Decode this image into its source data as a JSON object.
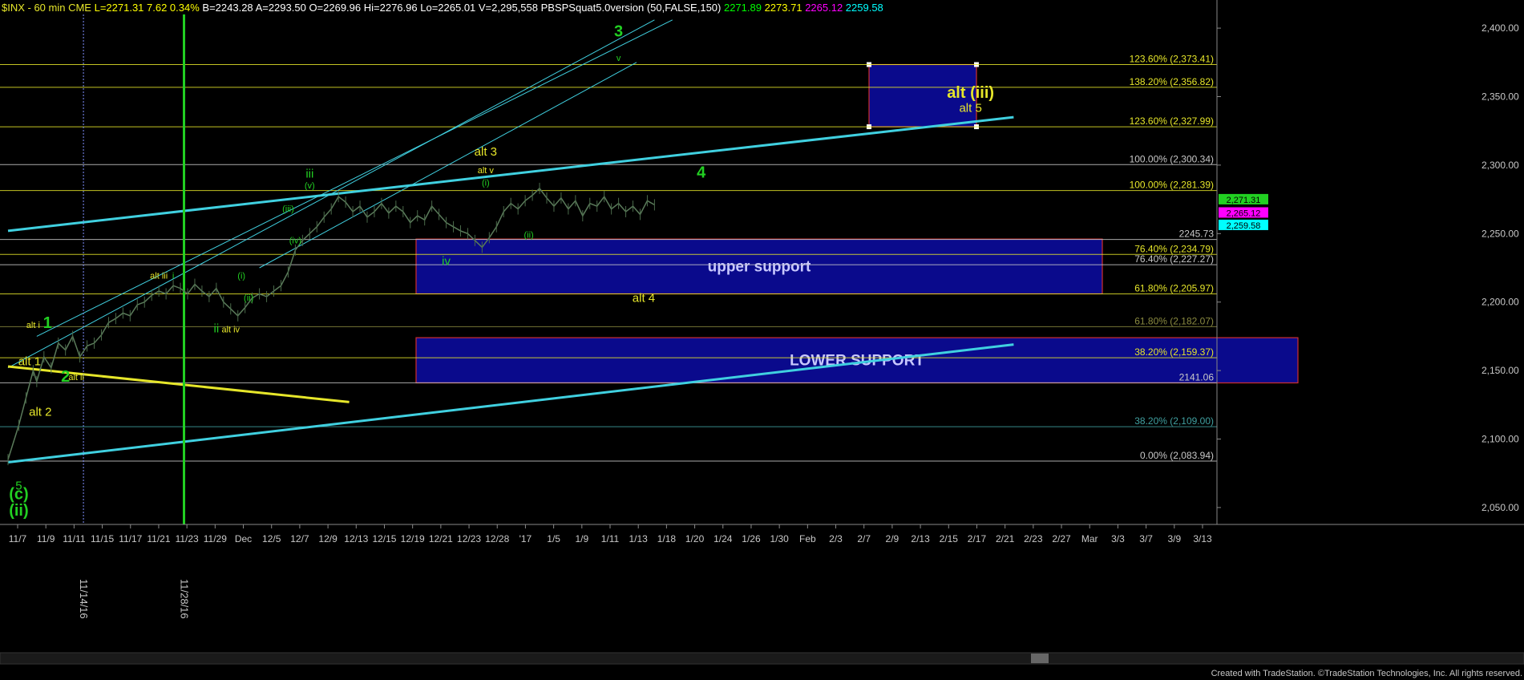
{
  "header": {
    "symbol": "$INX - 60 min  CME",
    "segments": [
      {
        "text": "L=2271.31  7.62  0.34%",
        "color": "#ffff00"
      },
      {
        "text": "B=2243.28",
        "color": "#ffffff"
      },
      {
        "text": "A=2293.50",
        "color": "#ffffff"
      },
      {
        "text": "O=2269.96",
        "color": "#ffffff"
      },
      {
        "text": "Hi=2276.96",
        "color": "#ffffff"
      },
      {
        "text": "Lo=2265.01",
        "color": "#ffffff"
      },
      {
        "text": "V=2,295,558",
        "color": "#ffffff"
      },
      {
        "text": "PBSPSquat5.0version (50,FALSE,150)",
        "color": "#ffffff"
      },
      {
        "text": "2271.89",
        "color": "#00ff00"
      },
      {
        "text": "2273.71",
        "color": "#ffff00"
      },
      {
        "text": "2265.12",
        "color": "#ff00ff"
      },
      {
        "text": "2259.58",
        "color": "#00ffff"
      }
    ]
  },
  "footer": {
    "credit": "Created with TradeStation. ©TradeStation Technologies, Inc. All rights reserved."
  },
  "colors": {
    "background": "#000000",
    "price_line": "#5a7a5a",
    "trend_cyan": "#40d0e0",
    "trend_yellow": "#e6e62a",
    "marker_green": "#22d022",
    "box_fill": "#0a0a8c",
    "box_border": "#d03030",
    "label_yellow": "#e6e62a",
    "label_green": "#22d022"
  },
  "chart_data": {
    "type": "line",
    "title": "$INX - 60 min",
    "ylim": [
      2040,
      2410
    ],
    "y_ticks": [
      "2,050.00",
      "2,100.00",
      "2,150.00",
      "2,200.00",
      "2,250.00",
      "2,300.00",
      "2,350.00",
      "2,400.00"
    ],
    "x_ticks": [
      "11/7",
      "11/9",
      "11/11",
      "11/15",
      "11/17",
      "11/21",
      "11/23",
      "11/29",
      "Dec",
      "12/5",
      "12/7",
      "12/9",
      "12/13",
      "12/15",
      "12/19",
      "12/21",
      "12/23",
      "12/28",
      "'17",
      "1/5",
      "1/9",
      "1/11",
      "1/13",
      "1/18",
      "1/20",
      "1/24",
      "1/26",
      "1/30",
      "Feb",
      "2/3",
      "2/7",
      "2/9",
      "2/13",
      "2/15",
      "2/17",
      "2/21",
      "2/23",
      "2/27",
      "Mar",
      "3/3",
      "3/7",
      "3/9",
      "3/13"
    ],
    "x_index": "bar index (0 = 11/4 close, 11/7 starts at 1)",
    "series": [
      {
        "values_by_bar": [
          [
            0,
            2085
          ],
          [
            3,
            2110
          ],
          [
            5,
            2130
          ],
          [
            7,
            2150
          ],
          [
            8,
            2142
          ],
          [
            10,
            2160
          ],
          [
            12,
            2152
          ],
          [
            14,
            2170
          ],
          [
            16,
            2165
          ],
          [
            18,
            2175
          ],
          [
            20,
            2160
          ],
          [
            22,
            2168
          ],
          [
            24,
            2170
          ],
          [
            26,
            2176
          ],
          [
            28,
            2185
          ],
          [
            30,
            2188
          ],
          [
            32,
            2192
          ],
          [
            34,
            2190
          ],
          [
            36,
            2198
          ],
          [
            38,
            2200
          ],
          [
            40,
            2205
          ],
          [
            42,
            2208
          ],
          [
            44,
            2206
          ],
          [
            46,
            2212
          ],
          [
            48,
            2210
          ],
          [
            50,
            2206
          ],
          [
            52,
            2213
          ],
          [
            54,
            2208
          ],
          [
            56,
            2204
          ],
          [
            58,
            2210
          ],
          [
            60,
            2200
          ],
          [
            62,
            2195
          ],
          [
            64,
            2190
          ],
          [
            66,
            2196
          ],
          [
            68,
            2203
          ],
          [
            70,
            2206
          ],
          [
            72,
            2204
          ],
          [
            74,
            2208
          ],
          [
            76,
            2212
          ],
          [
            78,
            2222
          ],
          [
            80,
            2238
          ],
          [
            82,
            2245
          ],
          [
            84,
            2250
          ],
          [
            86,
            2255
          ],
          [
            88,
            2262
          ],
          [
            90,
            2268
          ],
          [
            92,
            2277
          ],
          [
            94,
            2273
          ],
          [
            96,
            2266
          ],
          [
            98,
            2270
          ],
          [
            100,
            2262
          ],
          [
            102,
            2266
          ],
          [
            104,
            2272
          ],
          [
            106,
            2265
          ],
          [
            108,
            2270
          ],
          [
            110,
            2266
          ],
          [
            112,
            2258
          ],
          [
            114,
            2263
          ],
          [
            116,
            2260
          ],
          [
            118,
            2270
          ],
          [
            120,
            2264
          ],
          [
            122,
            2258
          ],
          [
            124,
            2255
          ],
          [
            126,
            2252
          ],
          [
            128,
            2250
          ],
          [
            130,
            2245
          ],
          [
            132,
            2240
          ],
          [
            134,
            2247
          ],
          [
            136,
            2255
          ],
          [
            138,
            2266
          ],
          [
            140,
            2272
          ],
          [
            142,
            2268
          ],
          [
            144,
            2274
          ],
          [
            146,
            2278
          ],
          [
            148,
            2283
          ],
          [
            150,
            2276
          ],
          [
            152,
            2270
          ],
          [
            154,
            2276
          ],
          [
            156,
            2268
          ],
          [
            158,
            2274
          ],
          [
            160,
            2263
          ],
          [
            162,
            2272
          ],
          [
            164,
            2270
          ],
          [
            166,
            2277
          ],
          [
            168,
            2268
          ],
          [
            170,
            2272
          ],
          [
            172,
            2266
          ],
          [
            174,
            2270
          ],
          [
            176,
            2264
          ],
          [
            178,
            2274
          ],
          [
            180,
            2271
          ]
        ]
      }
    ],
    "horizontal_levels": [
      {
        "label": "123.60% (2,373.41)",
        "value": 2373.41,
        "color": "#e6e62a"
      },
      {
        "label": "138.20% (2,356.82)",
        "value": 2356.82,
        "color": "#e6e62a"
      },
      {
        "label": "123.60% (2,327.99)",
        "value": 2327.99,
        "color": "#e6e62a"
      },
      {
        "label": "100.00% (2,300.34)",
        "value": 2300.34,
        "color": "#c8c8c8"
      },
      {
        "label": "100.00% (2,281.39)",
        "value": 2281.39,
        "color": "#e6e62a"
      },
      {
        "label": "2245.73",
        "value": 2245.73,
        "color": "#c8c8c8"
      },
      {
        "label": "76.40% (2,234.79)",
        "value": 2234.79,
        "color": "#e6e62a"
      },
      {
        "label": "76.40% (2,227.27)",
        "value": 2227.27,
        "color": "#c8c8c8"
      },
      {
        "label": "61.80% (2,205.97)",
        "value": 2205.97,
        "color": "#e6e62a"
      },
      {
        "label": "61.80% (2,182.07)",
        "value": 2182.07,
        "color": "#8a8a40"
      },
      {
        "label": "38.20% (2,159.37)",
        "value": 2159.37,
        "color": "#e6e62a"
      },
      {
        "label": "2141.06",
        "value": 2141.06,
        "color": "#c8c8c8"
      },
      {
        "label": "38.20% (2,109.00)",
        "value": 2109.0,
        "color": "#40a0a0"
      },
      {
        "label": "0.00% (2,083.94)",
        "value": 2083.94,
        "color": "#c8c8c8"
      }
    ],
    "right_price_tags": [
      {
        "text": "2,271.31",
        "color": "#22d022"
      },
      {
        "text": "2,265.12",
        "color": "#ff00ff"
      },
      {
        "text": "2,259.58",
        "color": "#00ffff"
      }
    ],
    "zones": [
      {
        "label": "",
        "x_from_bar": 160,
        "x_to_bar": 178,
        "y_from": 2328,
        "y_to": 2373.41
      },
      {
        "label": "upper support",
        "x_from_bar": 80,
        "x_to_bar": 210,
        "y_from": 2206,
        "y_to": 2246
      },
      {
        "label": "LOWER SUPPORT",
        "x_from_bar": 80,
        "x_to_bar": 245,
        "y_from": 2141,
        "y_to": 2174
      }
    ],
    "trendlines": [
      {
        "color": "cyan",
        "x1": 0,
        "y1": 2252,
        "x2": 280,
        "y2": 2335
      },
      {
        "color": "cyan",
        "x1": 0,
        "y1": 2083,
        "x2": 280,
        "y2": 2169
      },
      {
        "color": "cyan",
        "x1": 0,
        "y1": 2152,
        "x2": 180,
        "y2": 2406
      },
      {
        "color": "cyan",
        "x1": 8,
        "y1": 2175,
        "x2": 185,
        "y2": 2406
      },
      {
        "color": "cyan",
        "x1": 70,
        "y1": 2225,
        "x2": 175,
        "y2": 2375
      },
      {
        "color": "yellow",
        "x1": 0,
        "y1": 2153,
        "x2": 95,
        "y2": 2127
      }
    ],
    "vertical_markers": [
      {
        "label": "11/14/16",
        "bar": 21,
        "color": "#8090ff"
      },
      {
        "label": "11/28/16",
        "bar": 49,
        "color": "#22d022"
      }
    ],
    "annotations": [
      {
        "text": "3",
        "color": "#22d022",
        "size": "big",
        "bar": 170,
        "y": 2394
      },
      {
        "text": "v",
        "color": "#22d022",
        "size": "small",
        "bar": 170,
        "y": 2376
      },
      {
        "text": "alt (iii)",
        "color": "#e6e62a",
        "size": "big",
        "bar": 268,
        "y": 2349
      },
      {
        "text": "alt 5",
        "color": "#e6e62a",
        "size": "mid",
        "bar": 268,
        "y": 2339
      },
      {
        "text": "alt 3",
        "color": "#e6e62a",
        "size": "mid",
        "bar": 133,
        "y": 2307
      },
      {
        "text": "alt v",
        "color": "#e6e62a",
        "size": "small",
        "bar": 133,
        "y": 2294
      },
      {
        "text": "(i)",
        "color": "#22d022",
        "size": "small",
        "bar": 133,
        "y": 2285
      },
      {
        "text": "4",
        "color": "#22d022",
        "size": "big",
        "bar": 193,
        "y": 2291
      },
      {
        "text": "iii",
        "color": "#22d022",
        "size": "mid",
        "bar": 84,
        "y": 2291
      },
      {
        "text": "(v)",
        "color": "#22d022",
        "size": "small",
        "bar": 84,
        "y": 2283
      },
      {
        "text": "(iii)",
        "color": "#22d022",
        "size": "small",
        "bar": 78,
        "y": 2266
      },
      {
        "text": "(iv)",
        "color": "#22d022",
        "size": "small",
        "bar": 80,
        "y": 2243
      },
      {
        "text": "(ii)",
        "color": "#22d022",
        "size": "small",
        "bar": 145,
        "y": 2247
      },
      {
        "text": "iv",
        "color": "#22d022",
        "size": "mid",
        "bar": 122,
        "y": 2227
      },
      {
        "text": "(i)",
        "color": "#22d022",
        "size": "small",
        "bar": 65,
        "y": 2217
      },
      {
        "text": "(ii)",
        "color": "#22d022",
        "size": "small",
        "bar": 67,
        "y": 2201
      },
      {
        "text": "alt 4",
        "color": "#e6e62a",
        "size": "mid",
        "bar": 177,
        "y": 2200
      },
      {
        "text": "alt iii",
        "color": "#e6e62a",
        "size": "small",
        "bar": 42,
        "y": 2217
      },
      {
        "text": "i",
        "color": "#22d022",
        "size": "small",
        "bar": 46,
        "y": 2217
      },
      {
        "text": "ii",
        "color": "#22d022",
        "size": "mid",
        "bar": 58,
        "y": 2178
      },
      {
        "text": "alt iv",
        "color": "#e6e62a",
        "size": "small",
        "bar": 62,
        "y": 2178
      },
      {
        "text": "alt i",
        "color": "#e6e62a",
        "size": "small",
        "bar": 7,
        "y": 2181
      },
      {
        "text": "1",
        "color": "#22d022",
        "size": "big",
        "bar": 11,
        "y": 2181
      },
      {
        "text": "alt 1",
        "color": "#e6e62a",
        "size": "mid",
        "bar": 6,
        "y": 2154
      },
      {
        "text": "2",
        "color": "#22d022",
        "size": "big",
        "bar": 16,
        "y": 2142
      },
      {
        "text": "alt ii",
        "color": "#e6e62a",
        "size": "small",
        "bar": 19,
        "y": 2143
      },
      {
        "text": "alt 2",
        "color": "#e6e62a",
        "size": "mid",
        "bar": 9,
        "y": 2117
      },
      {
        "text": "5",
        "color": "#22d022",
        "size": "mid",
        "bar": 3,
        "y": 2063
      },
      {
        "text": "(c)",
        "color": "#22d022",
        "size": "big",
        "bar": 3,
        "y": 2056
      },
      {
        "text": "(ii)",
        "color": "#22d022",
        "size": "big",
        "bar": 3,
        "y": 2044
      }
    ]
  }
}
